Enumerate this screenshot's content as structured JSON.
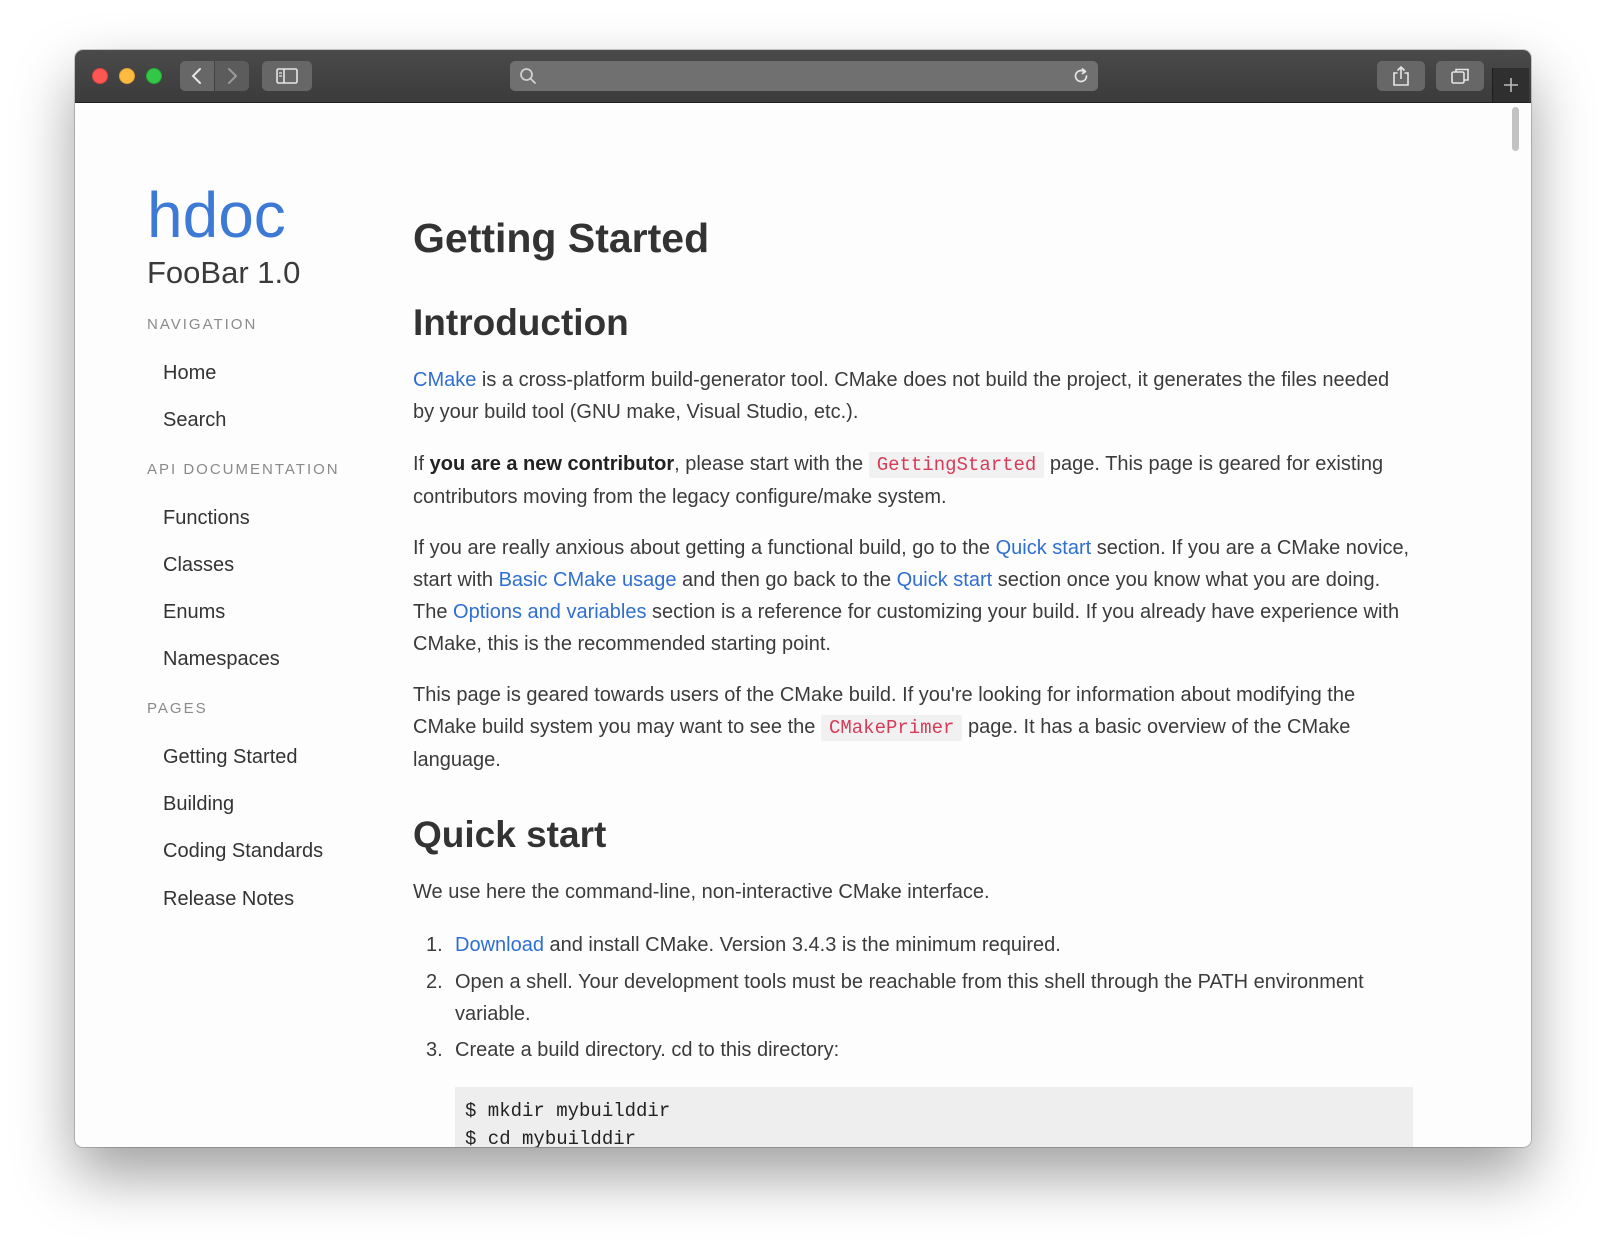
{
  "sidebar": {
    "logo": "hdoc",
    "project": "FooBar 1.0",
    "sections": [
      {
        "heading": "NAVIGATION",
        "items": [
          "Home",
          "Search"
        ]
      },
      {
        "heading": "API DOCUMENTATION",
        "items": [
          "Functions",
          "Classes",
          "Enums",
          "Namespaces"
        ]
      },
      {
        "heading": "PAGES",
        "items": [
          "Getting Started",
          "Building",
          "Coding Standards",
          "Release Notes"
        ]
      }
    ]
  },
  "page": {
    "title": "Getting Started",
    "introduction": {
      "heading": "Introduction",
      "p1": {
        "link": "CMake",
        "text": " is a cross-platform build-generator tool. CMake does not build the project, it generates the files needed by your build tool (GNU make, Visual Studio, etc.)."
      },
      "p2": {
        "pre": "If ",
        "bold": "you are a new contributor",
        "mid": ", please start with the ",
        "code": "GettingStarted",
        "post": " page. This page is geared for existing contributors moving from the legacy configure/make system."
      },
      "p3": {
        "t1": "If you are really anxious about getting a functional build, go to the ",
        "l1": "Quick start",
        "t2": " section. If you are a CMake novice, start with ",
        "l2": "Basic CMake usage",
        "t3": " and then go back to the ",
        "l3": "Quick start",
        "t4": " section once you know what you are doing. The ",
        "l4": "Options and variables",
        "t5": " section is a reference for customizing your build. If you already have experience with CMake, this is the recommended starting point."
      },
      "p4": {
        "pre": "This page is geared towards users of the CMake build. If you're looking for information about modifying the CMake build system you may want to see the ",
        "code": "CMakePrimer",
        "post": " page. It has a basic overview of the CMake language."
      }
    },
    "quickstart": {
      "heading": "Quick start",
      "intro": "We use here the command-line, non-interactive CMake interface.",
      "steps": [
        {
          "num": "1.",
          "link": "Download",
          "text": " and install CMake. Version 3.4.3 is the minimum required."
        },
        {
          "num": "2.",
          "link": "",
          "text": "Open a shell. Your development tools must be reachable from this shell through the PATH environment variable."
        },
        {
          "num": "3.",
          "link": "",
          "text": "Create a build directory. cd to this directory:"
        }
      ],
      "code": "$ mkdir mybuilddir\n$ cd mybuilddir"
    }
  }
}
